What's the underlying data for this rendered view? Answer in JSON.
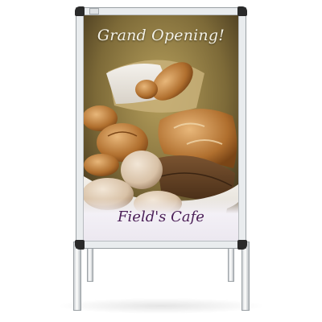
{
  "poster": {
    "headline": "Grand Opening!",
    "business_name": "Field's Cafe"
  },
  "colors": {
    "frame": "#e9ecee",
    "corners": "#2a2a2a",
    "headline_text": "#f3f1e6",
    "business_text": "#4b1f57",
    "background": "#ffffff"
  }
}
